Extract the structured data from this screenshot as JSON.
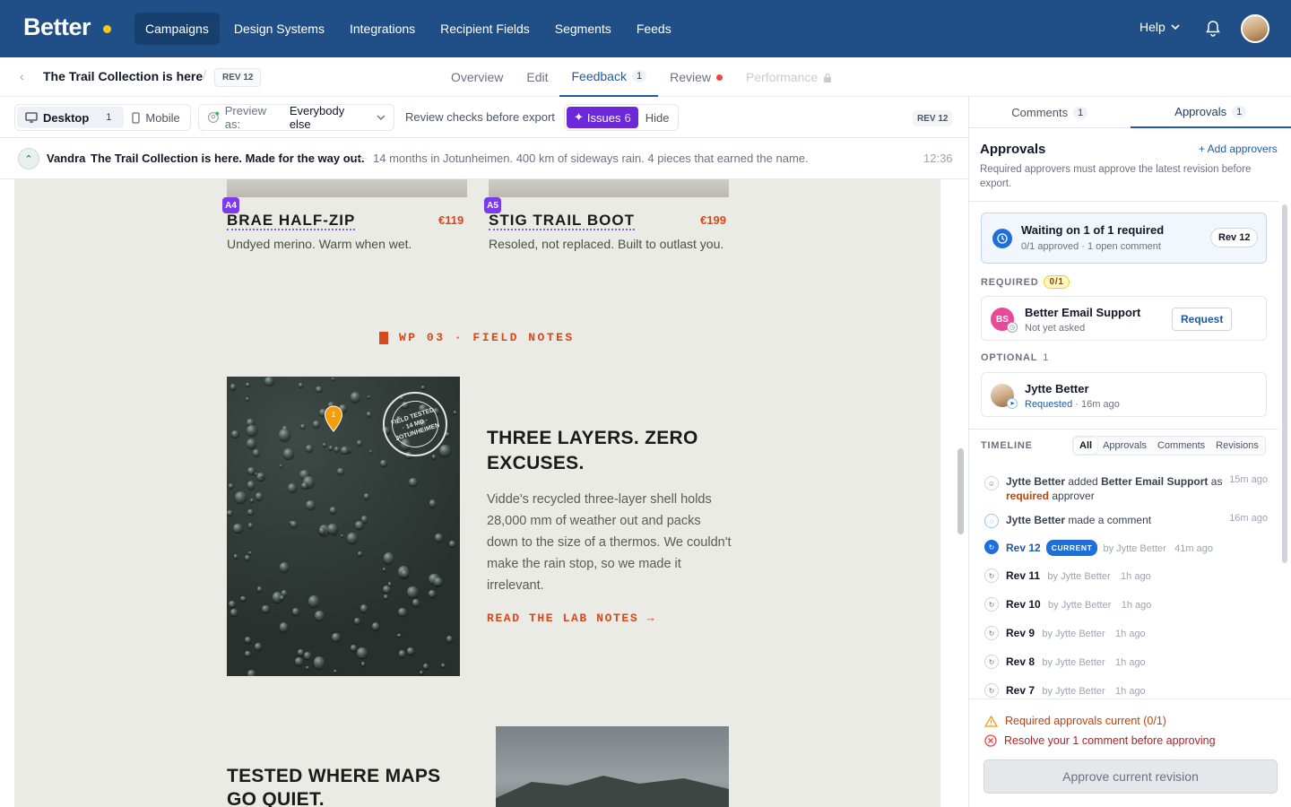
{
  "brand": {
    "name": "Better",
    "dot_color": "#f5c518",
    "accent": "#1f4f86"
  },
  "nav": {
    "items": [
      "Campaigns",
      "Design Systems",
      "Integrations",
      "Recipient Fields",
      "Segments",
      "Feeds"
    ],
    "active": "Campaigns",
    "help": "Help"
  },
  "subbar": {
    "title": "The Trail Collection is here",
    "rev": "REV 12",
    "tabs": [
      {
        "label": "Overview"
      },
      {
        "label": "Edit"
      },
      {
        "label": "Feedback",
        "count": "1"
      },
      {
        "label": "Review"
      },
      {
        "label": "Performance"
      }
    ],
    "active_tab": "Feedback"
  },
  "toolbar": {
    "desktop": "Desktop",
    "desktop_count": "1",
    "mobile": "Mobile",
    "preview_prefix": "Preview as:",
    "preview_value": "Everybody else",
    "review_checks": "Review checks before export",
    "issues": "Issues",
    "issues_count": "6",
    "hide": "Hide",
    "rev": "REV 12"
  },
  "message": {
    "sender": "Vandra",
    "subject": "The Trail Collection is here. Made for the way out.",
    "dash": "—",
    "preheader": "14 months in Jotunheimen. 400 km of sideways rain. 4 pieces that earned the name.",
    "time": "12:36"
  },
  "email": {
    "products": [
      {
        "tag": "A4",
        "name": "BRAE HALF-ZIP",
        "price": "€119",
        "desc": "Undyed merino. Warm when wet."
      },
      {
        "tag": "A5",
        "name": "STIG TRAIL BOOT",
        "price": "€199",
        "desc": "Resoled, not replaced. Built to outlast you."
      }
    ],
    "section_label": "WP 03 · FIELD NOTES",
    "stamp": "FIELD TESTED · 14 MO · JOTUNHEIMEN",
    "pin": "1",
    "headline": "THREE LAYERS. ZERO EXCUSES.",
    "body": "Vidde's recycled three-layer shell holds 28,000 mm of weather out and packs down to the size of a thermos. We couldn't make the rain stop, so we made it irrelevant.",
    "cta": "READ THE LAB NOTES →",
    "headline2": "TESTED WHERE MAPS GO QUIET."
  },
  "panel": {
    "tabs": [
      {
        "label": "Comments",
        "count": "1"
      },
      {
        "label": "Approvals",
        "count": "1"
      }
    ],
    "active_tab": "Approvals",
    "title": "Approvals",
    "add": "+ Add approvers",
    "desc": "Required approvers must approve the latest revision before export.",
    "waiting": {
      "title": "Waiting on 1 of 1 required",
      "sub": "0/1 approved · 1 open comment",
      "rev": "Rev 12"
    },
    "required": {
      "label": "REQUIRED",
      "count": "0/1",
      "name": "Better Email Support",
      "initials": "BS",
      "status": "Not yet asked",
      "button": "Request"
    },
    "optional": {
      "label": "OPTIONAL",
      "count": "1",
      "name": "Jytte Better",
      "status": "Requested",
      "time": "16m ago"
    },
    "timeline": {
      "label": "TIMELINE",
      "filters": [
        "All",
        "Approvals",
        "Comments",
        "Revisions"
      ],
      "active_filter": "All",
      "events": [
        {
          "actor": "Jytte Better",
          "text1": " added ",
          "target": "Better Email Support",
          "text2": " as ",
          "role": "required",
          "text3": " approver",
          "time": "15m ago"
        },
        {
          "actor": "Jytte Better",
          "text1": " made a comment",
          "time": "16m ago"
        }
      ],
      "revisions": [
        {
          "rev": "Rev 12",
          "current": "CURRENT",
          "by": "by Jytte Better",
          "time": "41m ago"
        },
        {
          "rev": "Rev 11",
          "by": "by Jytte Better",
          "time": "1h ago"
        },
        {
          "rev": "Rev 10",
          "by": "by Jytte Better",
          "time": "1h ago"
        },
        {
          "rev": "Rev 9",
          "by": "by Jytte Better",
          "time": "1h ago"
        },
        {
          "rev": "Rev 8",
          "by": "by Jytte Better",
          "time": "1h ago"
        },
        {
          "rev": "Rev 7",
          "by": "by Jytte Better",
          "time": "1h ago"
        }
      ]
    },
    "footer": {
      "warn1": "Required approvals current (0/1)",
      "warn2": "Resolve your 1 comment before approving",
      "approve": "Approve current revision"
    }
  }
}
